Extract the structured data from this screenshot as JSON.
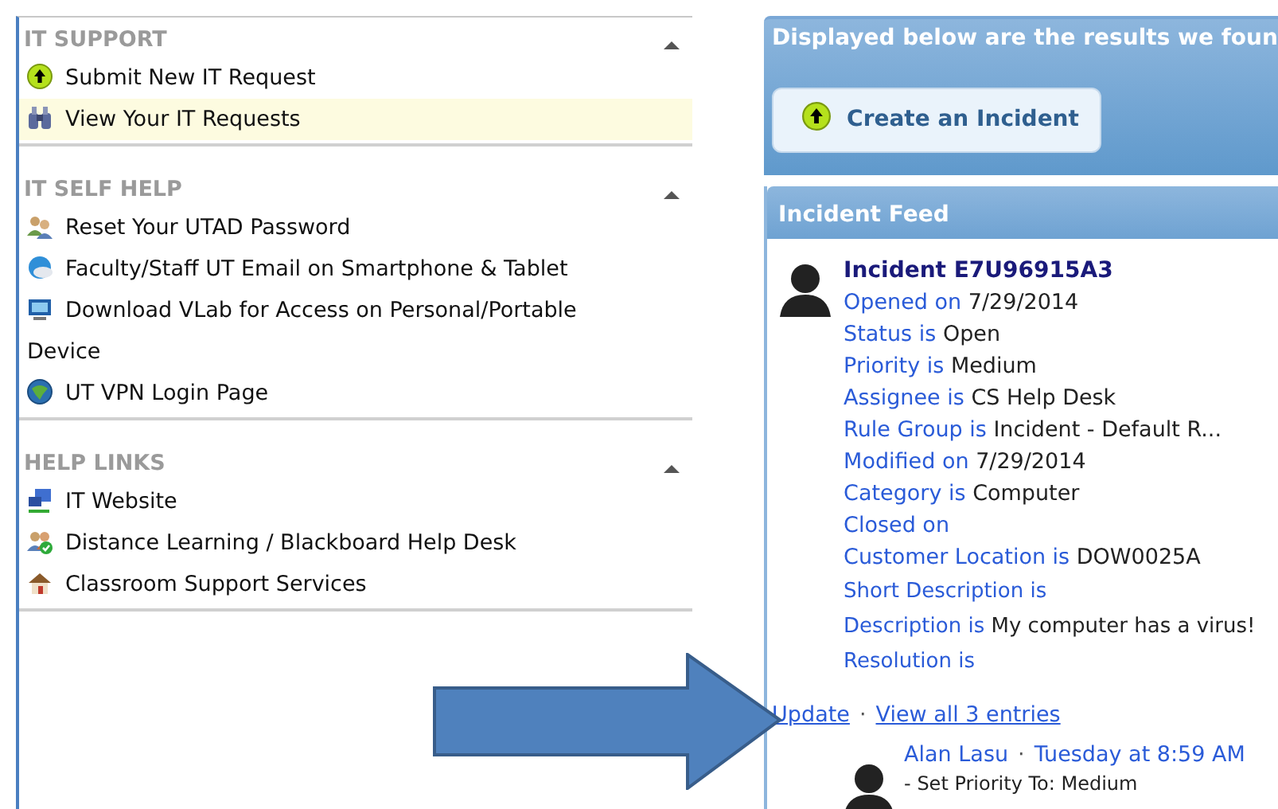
{
  "sidebar": {
    "sections": [
      {
        "title": "IT SUPPORT",
        "expanded": true,
        "items": [
          {
            "label": "Submit New IT Request",
            "kind": "upload",
            "selected": false
          },
          {
            "label": "View Your IT Requests",
            "kind": "binoculars",
            "selected": true
          }
        ]
      },
      {
        "title": "IT SELF HELP",
        "expanded": true,
        "items": [
          {
            "label": "Reset Your UTAD Password",
            "kind": "users",
            "selected": false
          },
          {
            "label": "Faculty/Staff UT Email on Smartphone & Tablet",
            "kind": "cloud",
            "selected": false
          },
          {
            "label": "Download VLab for Access on Personal/Portable Device",
            "kind": "monitor",
            "selected": false
          },
          {
            "label": "UT VPN Login Page",
            "kind": "globe",
            "selected": false
          }
        ]
      },
      {
        "title": "HELP LINKS",
        "expanded": true,
        "items": [
          {
            "label": "IT Website",
            "kind": "network",
            "selected": false
          },
          {
            "label": "Distance Learning / Blackboard Help Desk",
            "kind": "users-check",
            "selected": false
          },
          {
            "label": "Classroom Support Services",
            "kind": "house",
            "selected": false
          }
        ]
      }
    ]
  },
  "results": {
    "message": "Displayed below are the results we foun",
    "button": "Create an Incident"
  },
  "feed": {
    "title": "Incident Feed",
    "incident": {
      "title": "Incident E7U96915A3",
      "fields": [
        {
          "label": "Opened on",
          "value": "7/29/2014"
        },
        {
          "label": "Status is",
          "value": "Open"
        },
        {
          "label": "Priority is",
          "value": "Medium"
        },
        {
          "label": "Assignee is",
          "value": "CS Help Desk"
        },
        {
          "label": "Rule Group is",
          "value": "Incident - Default R..."
        },
        {
          "label": "Modified on",
          "value": "7/29/2014"
        },
        {
          "label": "Category is",
          "value": "Computer"
        },
        {
          "label": "Closed on"
        },
        {
          "label": "Customer Location is",
          "value": "DOW0025A"
        }
      ],
      "description_fields": [
        {
          "label": "Short Description is"
        },
        {
          "label": "Description is",
          "value": "My computer has a virus!"
        },
        {
          "label": "Resolution is"
        }
      ]
    },
    "links": [
      "Update",
      "View all 3 entries"
    ],
    "link_separator": "·",
    "entry": {
      "author": "Alan Lasu",
      "separator": "·",
      "time": "Tuesday at 8:59 AM",
      "text": "- Set Priority To: Medium"
    }
  }
}
